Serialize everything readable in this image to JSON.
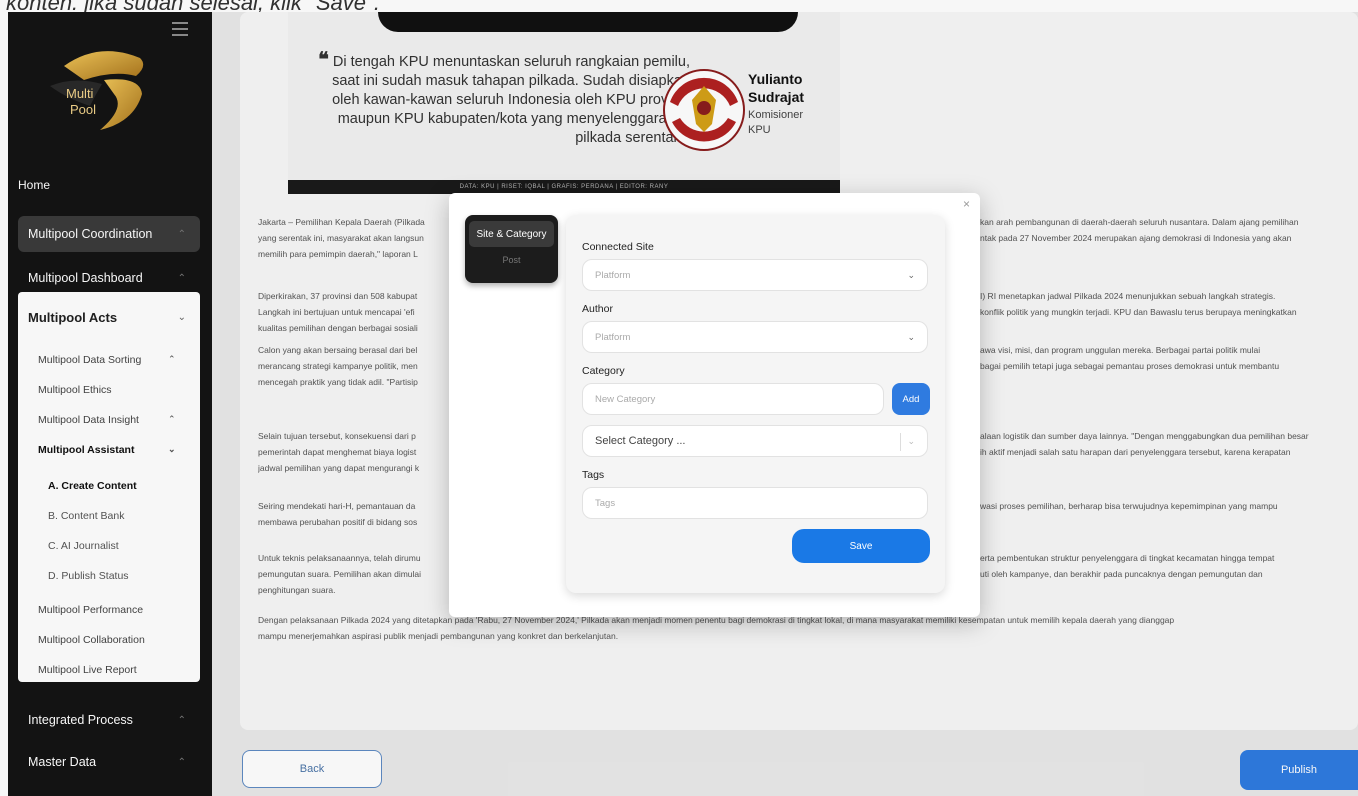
{
  "caption": "konten. jika sudah selesai, klik \"Save\".",
  "sidebar": {
    "logo_text": "Multi Pool",
    "home": "Home",
    "coordination": "Multipool Coordination",
    "dashboard": "Multipool Dashboard",
    "acts": {
      "title": "Multipool Acts",
      "items": [
        {
          "label": "Multipool Data Sorting"
        },
        {
          "label": "Multipool Ethics"
        },
        {
          "label": "Multipool Data Insight"
        },
        {
          "label": "Multipool Assistant"
        }
      ],
      "assistant_items": [
        {
          "label": "A. Create Content"
        },
        {
          "label": "B. Content Bank"
        },
        {
          "label": "C. AI Journalist"
        },
        {
          "label": "D. Publish Status"
        }
      ],
      "more_items": [
        {
          "label": "Multipool Performance"
        },
        {
          "label": "Multipool Collaboration"
        },
        {
          "label": "Multipool Live Report"
        }
      ]
    },
    "integrated": "Integrated Process",
    "master": "Master Data"
  },
  "article": {
    "quote": "Di tengah KPU menuntaskan seluruh rangkaian pemilu, saat ini sudah masuk tahapan pilkada. Sudah disiapkan oleh kawan-kawan seluruh Indonesia oleh KPU provinsi maupun KPU kabupaten/kota yang menyelenggarakan pilkada serentak.\"",
    "person_first": "Yulianto",
    "person_last": "Sudrajat",
    "role_line1": "Komisioner",
    "role_line2": "KPU",
    "credits": "DATA: KPU  |  RISET: IQBAL  |  GRAFIS: PERDANA  |  EDITOR: RANY",
    "paragraphs_left": [
      [
        "Jakarta – Pemilihan Kepala Daerah (Pilkada",
        "yang serentak ini, masyarakat akan langsun",
        "memilih para pemimpin daerah,\" laporan L"
      ],
      [
        "Diperkirakan, 37 provinsi dan 508 kabupat",
        "Langkah ini bertujuan untuk mencapai 'efi",
        "kualitas pemilihan dengan berbagai sosiali"
      ],
      [
        "Calon yang akan bersaing berasal dari bel",
        "merancang strategi kampanye politik, men",
        "mencegah praktik yang tidak adil. \"Partisip"
      ],
      [
        "Selain tujuan tersebut, konsekuensi dari p",
        "pemerintah dapat menghemat biaya logist",
        "jadwal pemilihan yang dapat mengurangi k"
      ],
      [
        "Seiring mendekati hari-H, pemantauan da",
        "membawa perubahan positif di bidang sos"
      ],
      [
        "Untuk teknis pelaksanaannya, telah dirumu",
        "pemungutan suara. Pemilihan akan dimulai",
        "penghitungan suara."
      ]
    ],
    "paragraphs_right": [
      [
        "kan arah pembangunan di daerah-daerah seluruh nusantara. Dalam ajang pemilihan",
        "ntak pada 27 November 2024 merupakan ajang demokrasi di Indonesia yang akan"
      ],
      [
        "I) RI menetapkan jadwal Pilkada 2024 menunjukkan sebuah langkah strategis.",
        "konflik politik yang mungkin terjadi. KPU dan Bawaslu terus berupaya meningkatkan"
      ],
      [
        "awa visi, misi, dan program unggulan mereka. Berbagai partai politik mulai",
        "bagai pemilih tetapi juga sebagai pemantau proses demokrasi untuk membantu"
      ],
      [
        "alaan logistik dan sumber daya lainnya. \"Dengan menggabungkan dua pemilihan besar",
        "ih aktif menjadi salah satu harapan dari penyelenggara tersebut, karena kerapatan"
      ],
      [
        "wasi proses pemilihan, berharap bisa terwujudnya kepemimpinan yang mampu"
      ],
      [
        "erta pembentukan struktur penyelenggara di tingkat kecamatan hingga tempat",
        "uti oleh kampanye, dan berakhir pada puncaknya dengan pemungutan dan"
      ]
    ],
    "final_para": [
      "Dengan pelaksanaan Pilkada 2024 yang ditetapkan pada 'Rabu, 27 November 2024,' Pilkada akan menjadi momen penentu bagi demokrasi di tingkat lokal, di mana masyarakat memiliki kesempatan untuk memilih kepala daerah yang dianggap",
      "mampu menerjemahkan aspirasi publik menjadi pembangunan yang konkret dan berkelanjutan."
    ]
  },
  "footer": {
    "back": "Back",
    "publish": "Publish"
  },
  "modal": {
    "close": "×",
    "tab_active": "Site & Category",
    "tab_post": "Post",
    "connected_site_label": "Connected Site",
    "connected_site_placeholder": "Platform",
    "author_label": "Author",
    "author_placeholder": "Platform",
    "category_label": "Category",
    "new_category_placeholder": "New Category",
    "add_label": "Add",
    "select_category": "Select Category ...",
    "tags_label": "Tags",
    "tags_placeholder": "Tags",
    "save_label": "Save"
  },
  "colors": {
    "sidebar_bg": "#141414",
    "accent_blue": "#2f7be0",
    "logo_gold": "#d9a430"
  }
}
